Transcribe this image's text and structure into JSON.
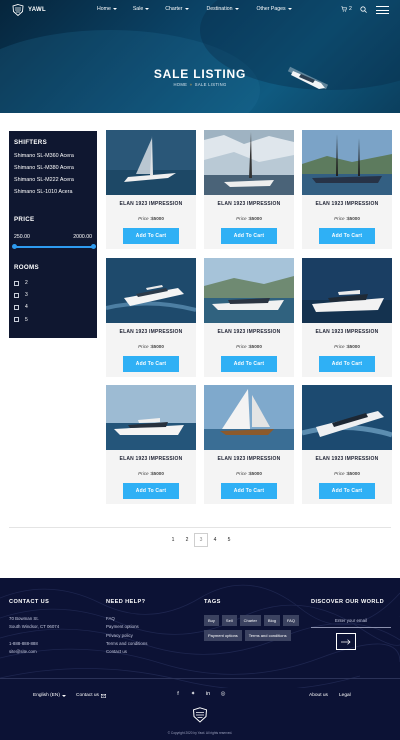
{
  "header": {
    "brand": "YAWL",
    "menu": [
      {
        "label": "Home",
        "has_caret": true
      },
      {
        "label": "Sale",
        "has_caret": true
      },
      {
        "label": "Charter",
        "has_caret": true
      },
      {
        "label": "Destination",
        "has_caret": true
      },
      {
        "label": "Other Pages",
        "has_caret": true
      }
    ],
    "cart_count": "2",
    "icons": [
      "logo-shield-icon",
      "cart-icon",
      "search-icon",
      "hamburger-menu-icon"
    ]
  },
  "hero": {
    "title": "SALE LISTING",
    "breadcrumb_home": "HOME",
    "breadcrumb_sep": "»",
    "breadcrumb_current": "SALE LISTING"
  },
  "sidebar": {
    "shifters_heading": "SHIFTERS",
    "shifters": [
      "Shimano SL-M360 Acera",
      "Shimano SL-M380 Acera",
      "Shimano SL-M222 Acera",
      "Shimano SL-1010 Acera"
    ],
    "price_heading": "PRICE",
    "price_min": "250.00",
    "price_max": "2000.00",
    "rooms_heading": "ROOMS",
    "rooms": [
      "2",
      "3",
      "4",
      "5"
    ]
  },
  "listings": [
    {
      "title": "ELAN 1923 IMPRESSION",
      "price_label": "Price :",
      "price": "$5000",
      "button": "Add To Cart"
    },
    {
      "title": "ELAN 1923 IMPRESSION",
      "price_label": "Price :",
      "price": "$5000",
      "button": "Add To Cart"
    },
    {
      "title": "ELAN 1923 IMPRESSION",
      "price_label": "Price :",
      "price": "$5000",
      "button": "Add To Cart"
    },
    {
      "title": "ELAN 1923 IMPRESSION",
      "price_label": "Price :",
      "price": "$5000",
      "button": "Add To Cart"
    },
    {
      "title": "ELAN 1923 IMPRESSION",
      "price_label": "Price :",
      "price": "$5000",
      "button": "Add To Cart"
    },
    {
      "title": "ELAN 1923 IMPRESSION",
      "price_label": "Price :",
      "price": "$5000",
      "button": "Add To Cart"
    },
    {
      "title": "ELAN 1923 IMPRESSION",
      "price_label": "Price :",
      "price": "$5000",
      "button": "Add To Cart"
    },
    {
      "title": "ELAN 1923 IMPRESSION",
      "price_label": "Price :",
      "price": "$5000",
      "button": "Add To Cart"
    },
    {
      "title": "ELAN 1923 IMPRESSION",
      "price_label": "Price :",
      "price": "$5000",
      "button": "Add To Cart"
    }
  ],
  "pagination": {
    "pages": [
      "1",
      "2",
      "3",
      "4",
      "5"
    ],
    "current": "3"
  },
  "footer": {
    "contact_heading": "CONTACT US",
    "address_line1": "70 Bowman St.",
    "address_line2": "South Windsor, CT 06074",
    "phone": "1-888-888-888",
    "email": "site@site.com",
    "help_heading": "NEED HELP?",
    "help_links": [
      "FAQ",
      "Payment options",
      "Privacy policy",
      "Terms and conditions",
      "Contact us"
    ],
    "tags_heading": "TAGS",
    "tags": [
      "Buy",
      "Sell",
      "Charter",
      "Blog",
      "FAQ",
      "Payment options",
      "Terms and conditions"
    ],
    "discover_heading": "DISCOVER OUR WORLD",
    "email_placeholder": "Enter your email",
    "language": "English (EN)",
    "contact_us_link": "Contact us",
    "social_icons": [
      "facebook-icon",
      "twitter-icon",
      "linkedin-icon",
      "instagram-icon"
    ],
    "about_link": "About us",
    "legal_link": "Legal",
    "copyright": "© Copyright 2020 by Yawl. All rights reserved."
  },
  "colors": {
    "accent": "#2fb0f5",
    "sidebar_bg": "#0f1730",
    "footer_bg": "#0c1235",
    "gold": "#e1a84b"
  }
}
